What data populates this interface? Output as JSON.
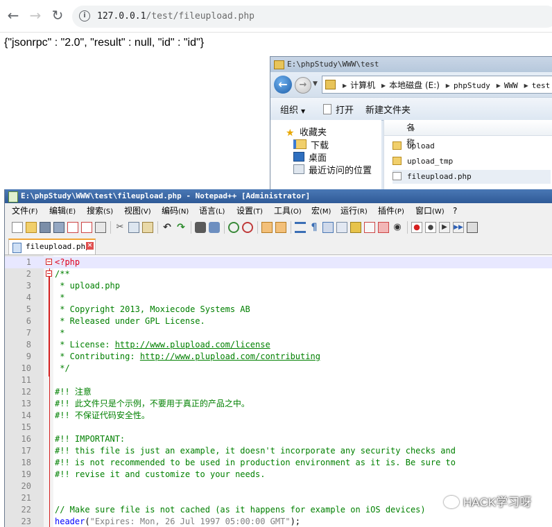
{
  "browser": {
    "url_host": "127.0.0.1",
    "url_path": "/test/fileupload.php",
    "response_text": "{\"jsonrpc\" : \"2.0\", \"result\" : null, \"id\" : \"id\"}"
  },
  "explorer": {
    "title": "E:\\phpStudy\\WWW\\test",
    "breadcrumbs": [
      "计算机",
      "本地磁盘 (E:)",
      "phpStudy",
      "WWW",
      "test"
    ],
    "toolbar": {
      "organize": "组织",
      "open": "打开",
      "new_folder": "新建文件夹"
    },
    "nav": {
      "favorites": "收藏夹",
      "downloads": "下载",
      "desktop": "桌面",
      "recent": "最近访问的位置"
    },
    "column_name": "名称",
    "files": [
      {
        "name": "upload",
        "type": "folder"
      },
      {
        "name": "upload_tmp",
        "type": "folder"
      },
      {
        "name": "fileupload.php",
        "type": "php"
      }
    ]
  },
  "npp": {
    "title": "E:\\phpStudy\\WWW\\test\\fileupload.php - Notepad++ [Administrator]",
    "menus": [
      {
        "label": "文件",
        "key": "(F)"
      },
      {
        "label": "编辑",
        "key": "(E)"
      },
      {
        "label": "搜索",
        "key": "(S)"
      },
      {
        "label": "视图",
        "key": "(V)"
      },
      {
        "label": "编码",
        "key": "(N)"
      },
      {
        "label": "语言",
        "key": "(L)"
      },
      {
        "label": "设置",
        "key": "(T)"
      },
      {
        "label": "工具",
        "key": "(O)"
      },
      {
        "label": "宏",
        "key": "(M)"
      },
      {
        "label": "运行",
        "key": "(R)"
      },
      {
        "label": "插件",
        "key": "(P)"
      },
      {
        "label": "窗口",
        "key": "(W)"
      },
      {
        "label": "?",
        "key": ""
      }
    ],
    "tab_label": "fileupload.php",
    "lines": [
      {
        "n": "1",
        "t": "<?php"
      },
      {
        "n": "2",
        "t": "/**"
      },
      {
        "n": "3",
        "t": " * upload.php"
      },
      {
        "n": "4",
        "t": " *"
      },
      {
        "n": "5",
        "t": " * Copyright 2013, Moxiecode Systems AB"
      },
      {
        "n": "6",
        "t": " * Released under GPL License."
      },
      {
        "n": "7",
        "t": " *"
      },
      {
        "n": "8",
        "t": " * License: ",
        "url": "http://www.plupload.com/license"
      },
      {
        "n": "9",
        "t": " * Contributing: ",
        "url": "http://www.plupload.com/contributing"
      },
      {
        "n": "10",
        "t": " */"
      },
      {
        "n": "11",
        "t": ""
      },
      {
        "n": "12",
        "t": "#!! 注意"
      },
      {
        "n": "13",
        "t": "#!! 此文件只是个示例，不要用于真正的产品之中。"
      },
      {
        "n": "14",
        "t": "#!! 不保证代码安全性。"
      },
      {
        "n": "15",
        "t": ""
      },
      {
        "n": "16",
        "t": "#!! IMPORTANT:"
      },
      {
        "n": "17",
        "t": "#!! this file is just an example, it doesn't incorporate any security checks and"
      },
      {
        "n": "18",
        "t": "#!! is not recommended to be used in production environment as it is. Be sure to"
      },
      {
        "n": "19",
        "t": "#!! revise it and customize to your needs."
      },
      {
        "n": "20",
        "t": ""
      },
      {
        "n": "21",
        "t": ""
      },
      {
        "n": "22",
        "t": "// Make sure file is not cached (as it happens for example on iOS devices)"
      },
      {
        "n": "23",
        "fn": "header",
        "p1": "(",
        "str": "\"Expires: Mon, 26 Jul 1997 05:00:00 GMT\"",
        "p2": ");"
      }
    ]
  },
  "watermark": "HACK学习呀"
}
